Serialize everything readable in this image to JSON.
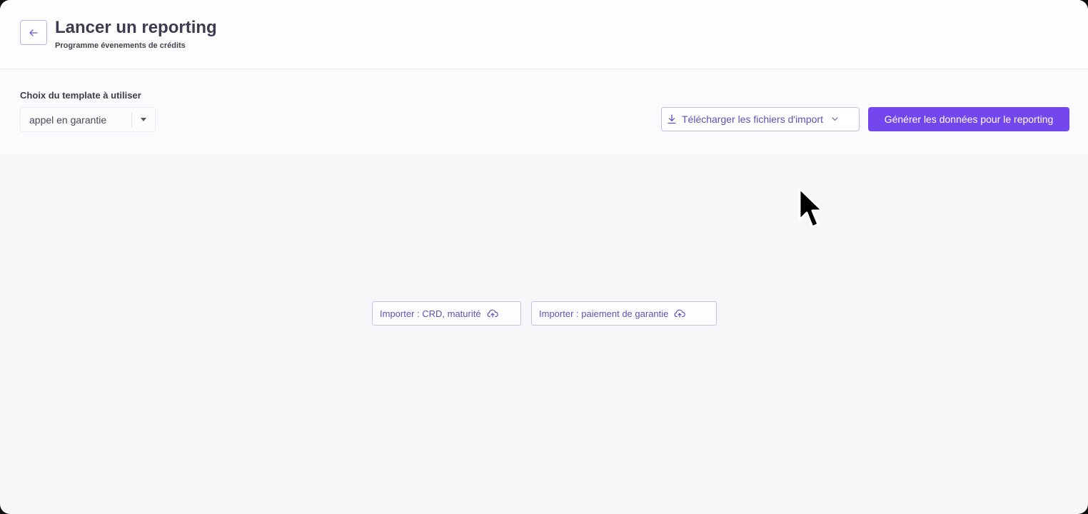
{
  "header": {
    "title": "Lancer un reporting",
    "subtitle": "Programme évenements de crédits",
    "back_icon": "arrow-left-icon"
  },
  "toolbar": {
    "template_label": "Choix du template à utiliser",
    "template_select": {
      "value": "appel en garantie",
      "icon": "caret-down-icon"
    },
    "download_button": {
      "label": "Télécharger les fichiers d'import",
      "icon": "download-icon",
      "chevron_icon": "chevron-down-icon"
    },
    "generate_button": {
      "label": "Générer les données pour le reporting"
    }
  },
  "main": {
    "import_buttons": [
      {
        "label": "Importer : CRD, maturité",
        "icon": "cloud-upload-icon"
      },
      {
        "label": "Importer : paiement de garantie",
        "icon": "cloud-upload-icon"
      }
    ]
  },
  "colors": {
    "accent": "#7446ee",
    "accent_text": "#5b4fb8",
    "background": "#f7f7fa",
    "title_text": "#3d3b4f"
  }
}
